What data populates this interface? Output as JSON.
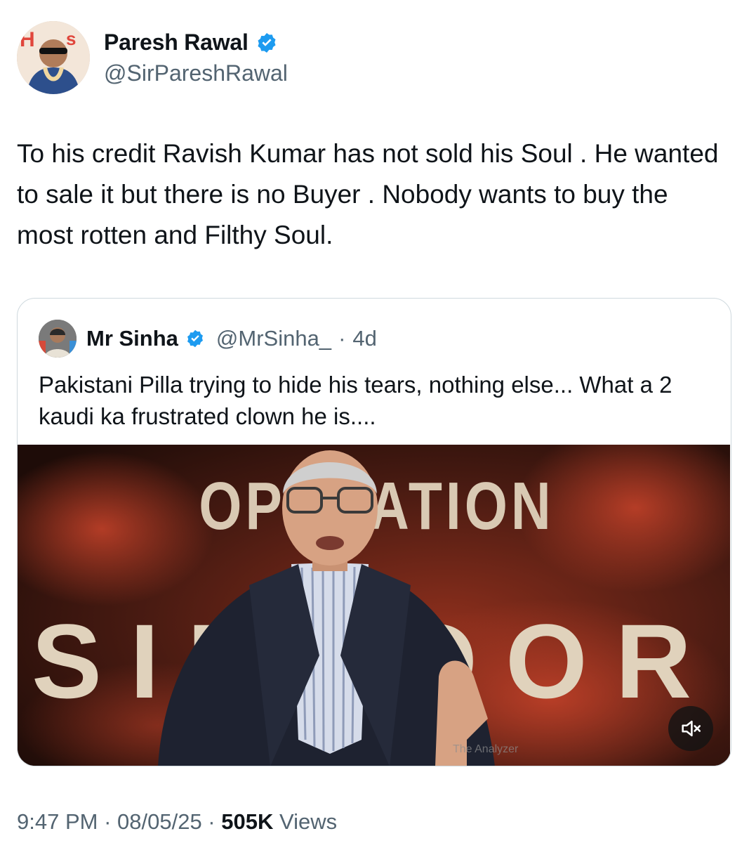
{
  "author": {
    "display_name": "Paresh Rawal",
    "handle": "@SirPareshRawal"
  },
  "tweet": {
    "text": "To his credit Ravish Kumar has not sold his Soul . He wanted to sale it but there is no Buyer . Nobody wants to buy the most rotten and Filthy Soul."
  },
  "quoted_tweet": {
    "display_name": "Mr Sinha",
    "handle": "@MrSinha_",
    "separator": "·",
    "age": "4d",
    "text": "Pakistani Pilla trying to hide his tears, nothing else...  What a 2 kaudi ka frustrated clown he is....",
    "media": {
      "type": "video",
      "overlay_text_top": "OPERATION",
      "overlay_text_bottom": "SINDOOR",
      "watermark": "The Analyzer",
      "mute_icon": "speaker-muted-icon"
    }
  },
  "meta": {
    "time": "9:47 PM",
    "sep1": " · ",
    "date": "08/05/25",
    "sep2": " · ",
    "views_count": "505K",
    "views_label": " Views"
  },
  "colors": {
    "verified": "#1d9bf0",
    "secondary_text": "#536471",
    "border": "#cfd9de"
  }
}
